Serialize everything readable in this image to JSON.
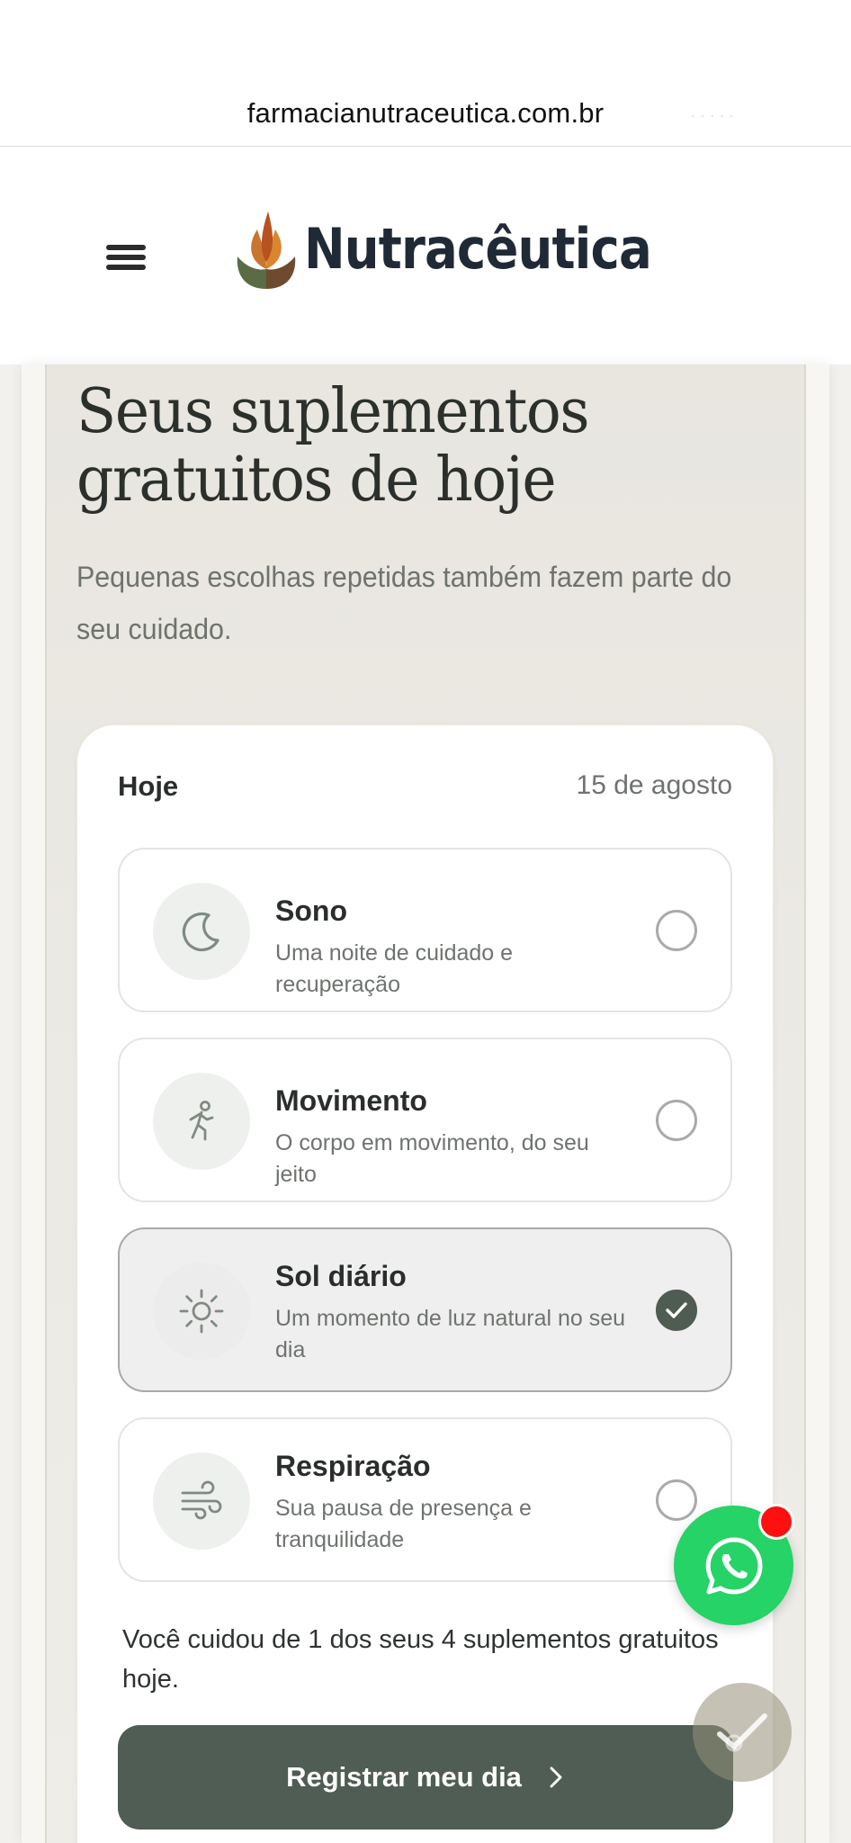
{
  "browser": {
    "url": "farmacianutraceutica.com.br"
  },
  "header": {
    "brand": "Nutracêutica"
  },
  "hero": {
    "title_line1": "Seus suplementos",
    "title_line2": "gratuitos de hoje",
    "subtitle_line1": "Pequenas escolhas repetidas também fazem parte do",
    "subtitle_line2": "seu cuidado."
  },
  "card": {
    "title": "Hoje",
    "date": "15 de agosto",
    "items": [
      {
        "title": "Sono",
        "desc1": "Uma noite de cuidado e recuperação",
        "desc2": "",
        "icon": "moon-icon",
        "checked": false
      },
      {
        "title": "Movimento",
        "desc1": "O corpo em movimento, do seu jeito",
        "desc2": "",
        "icon": "running-person-icon",
        "checked": false
      },
      {
        "title": "Sol diário",
        "desc1": "Um momento de luz natural no seu",
        "desc2": "dia",
        "icon": "sun-icon",
        "checked": true
      },
      {
        "title": "Respiração",
        "desc1": "Sua pausa de presença e",
        "desc2": "tranquilidade",
        "icon": "wind-icon",
        "checked": false
      }
    ],
    "summary_line1": "Você cuidou de 1 dos seus 4 suplementos gratuitos",
    "summary_line2": "hoje.",
    "cta_label": "Registrar meu dia"
  },
  "colors": {
    "accent": "#4f5d54",
    "whatsapp": "#25d366",
    "badge": "#ff1010",
    "icon_gray": "#7f8a82"
  }
}
